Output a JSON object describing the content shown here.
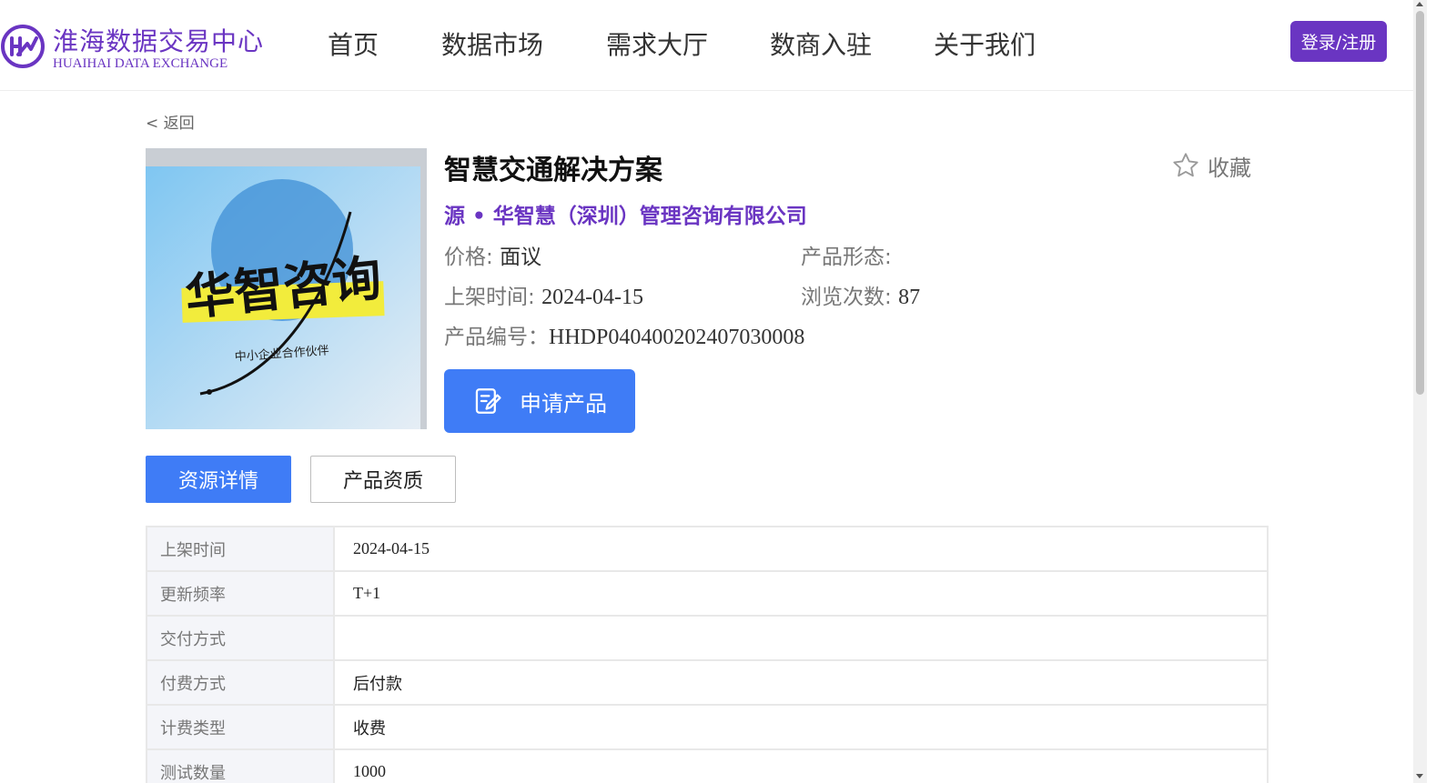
{
  "brand": {
    "name_cn": "淮海数据交易中心",
    "name_en": "HUAIHAI DATA EXCHANGE",
    "color": "#6a35c2",
    "logo_icon": "hd-monogram-icon"
  },
  "nav": {
    "items": [
      {
        "label": "首页"
      },
      {
        "label": "数据市场"
      },
      {
        "label": "需求大厅"
      },
      {
        "label": "数商入驻"
      },
      {
        "label": "关于我们"
      }
    ],
    "login_label": "登录/注册"
  },
  "back_label": "< 返回",
  "product": {
    "image_text": "华智咨询",
    "image_subtext": "中小企业合作伙伴",
    "title": "智慧交通解决方案",
    "favorite_label": "收藏",
    "favorite_icon": "star-outline-icon",
    "source": "源 • 华智慧（深圳）管理咨询有限公司",
    "price_label": "价格:",
    "price_value": "面议",
    "form_label": "产品形态:",
    "form_value": "",
    "listed_label": "上架时间:",
    "listed_value": "2024-04-15",
    "views_label": "浏览次数:",
    "views_value": "87",
    "code_label": "产品编号：",
    "code_value": "HHDP040400202407030008",
    "apply_label": "申请产品",
    "apply_icon": "edit-form-icon"
  },
  "tabs": [
    {
      "label": "资源详情",
      "active": true
    },
    {
      "label": "产品资质",
      "active": false
    }
  ],
  "accent_color": "#3f7cf6",
  "details": [
    {
      "key": "上架时间",
      "value": "2024-04-15"
    },
    {
      "key": "更新频率",
      "value": "T+1"
    },
    {
      "key": "交付方式",
      "value": ""
    },
    {
      "key": "付费方式",
      "value": "后付款"
    },
    {
      "key": "计费类型",
      "value": "收费"
    },
    {
      "key": "测试数量",
      "value": "1000"
    }
  ]
}
